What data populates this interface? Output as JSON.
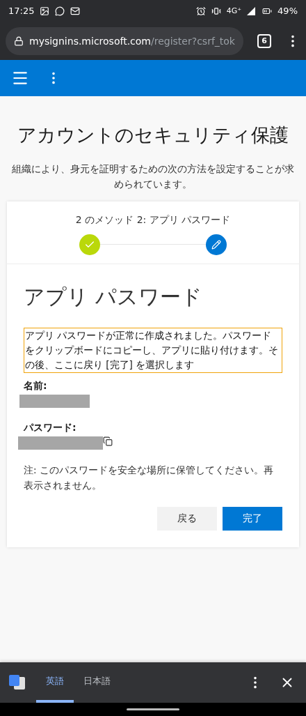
{
  "status_bar": {
    "time": "17:25",
    "network": "4G⁺",
    "battery": "49%"
  },
  "browser": {
    "url_host": "mysignins.microsoft.com",
    "url_path": "/register?csrf_tok",
    "tab_count": "6"
  },
  "page": {
    "title": "アカウントのセキュリティ保護",
    "subtitle": "組織により、身元を証明するための次の方法を設定することが求められています。"
  },
  "card": {
    "progress_label": "2 のメソッド 2: アプリ パスワード",
    "steps": [
      {
        "kind": "done"
      },
      {
        "kind": "current"
      }
    ],
    "heading": "アプリ パスワード",
    "message": "アプリ パスワードが正常に作成されました。パスワードをクリップボードにコピーし、アプリに貼り付けます。その後、ここに戻り [完了] を選択します",
    "fields": [
      {
        "label": "名前:",
        "copy": false
      },
      {
        "label": "パスワード:",
        "copy": true
      }
    ],
    "note": "注: このパスワードを安全な場所に保管してください。再表示されません。",
    "buttons": [
      {
        "label": "戻る",
        "kind": "secondary"
      },
      {
        "label": "完了",
        "kind": "primary"
      }
    ]
  },
  "translate_bar": {
    "languages": [
      {
        "label": "英語",
        "selected": true
      },
      {
        "label": "日本語",
        "selected": false
      }
    ]
  }
}
